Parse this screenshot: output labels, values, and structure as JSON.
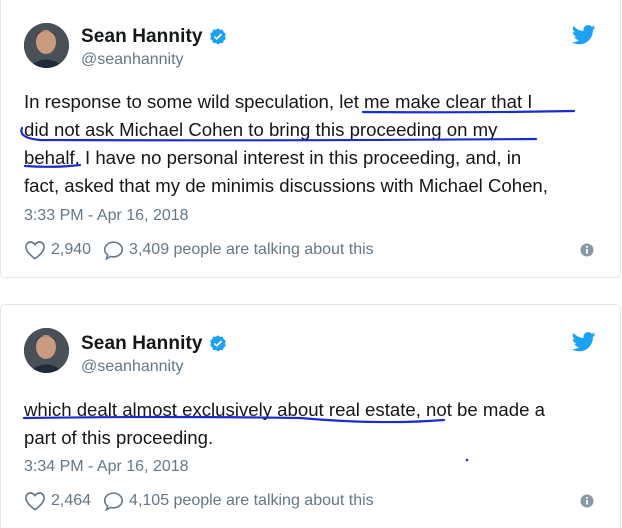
{
  "tweets": [
    {
      "author": {
        "name": "Sean Hannity",
        "handle": "@seanhannity",
        "verified": true
      },
      "text_lines": [
        "In response to some wild speculation, let me make clear that I",
        "did not ask Michael Cohen to bring this proceeding on my",
        "behalf, I have no personal interest in this proceeding, and, in",
        "fact, asked that my de minimis discussions with Michael Cohen,"
      ],
      "timestamp": "3:33 PM - Apr 16, 2018",
      "likes": "2,940",
      "talking": "3,409 people are talking about this"
    },
    {
      "author": {
        "name": "Sean Hannity",
        "handle": "@seanhannity",
        "verified": true
      },
      "text_lines": [
        "which dealt almost exclusively about real estate, not be made a",
        "part of this proceeding."
      ],
      "timestamp": "3:34 PM - Apr 16, 2018",
      "likes": "2,464",
      "talking": "4,105 people are talking about this"
    }
  ],
  "colors": {
    "text": "#14171a",
    "secondary": "#657786",
    "twitter_blue": "#1da1f2",
    "border": "#e1e8ed",
    "ink_underline": "#1a2bd1"
  },
  "icons": [
    "verified-badge-icon",
    "twitter-bird-icon",
    "heart-icon",
    "reply-bubble-icon",
    "info-icon"
  ]
}
